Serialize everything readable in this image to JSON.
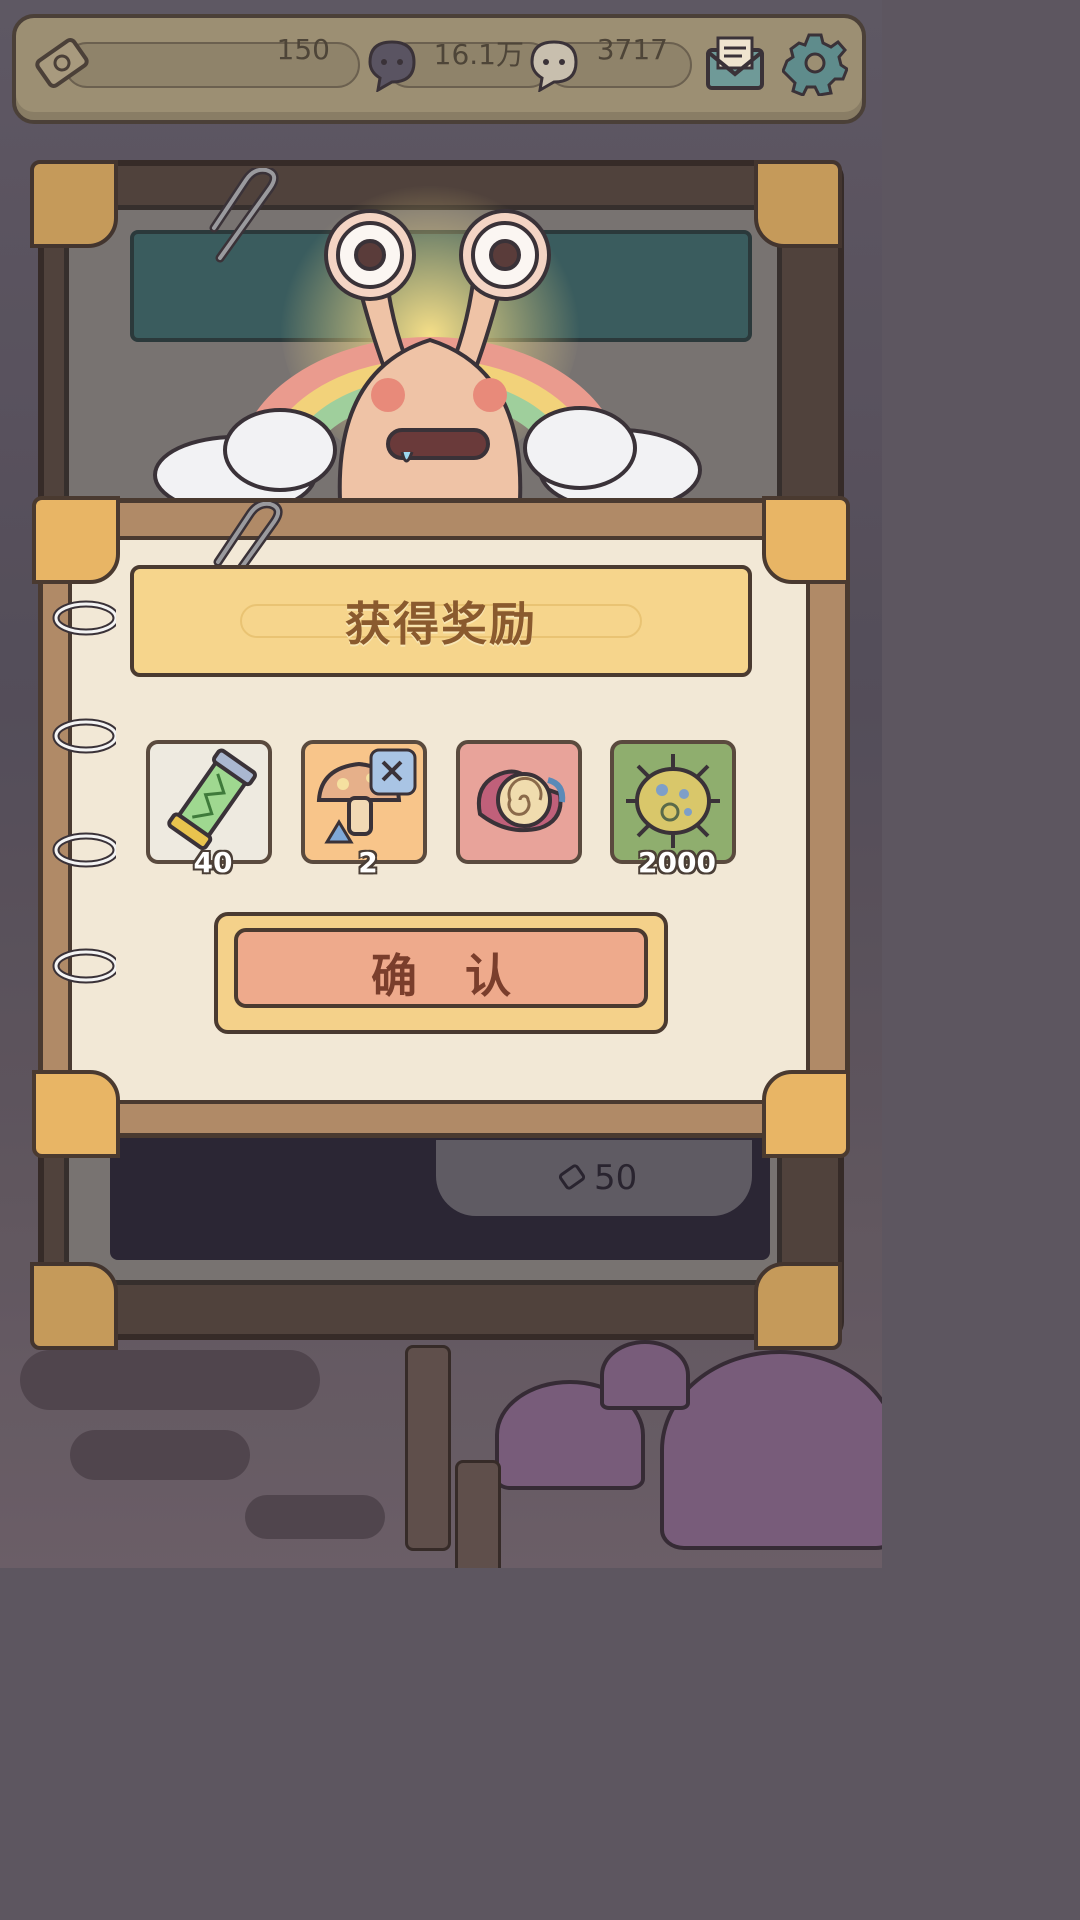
{
  "topbar": {
    "ticket_value": "150",
    "gem_value": "16.1万",
    "chat_value": "3717",
    "icons": [
      "ticket-icon",
      "dark-gem-icon",
      "chat-bubble-icon",
      "mail-icon",
      "gear-icon"
    ]
  },
  "popup": {
    "title": "获得奖励",
    "rewards": [
      {
        "icon": "battery-tube-icon",
        "count": "40",
        "bg": "#eeeae0"
      },
      {
        "icon": "mushroom-card-icon",
        "count": "2",
        "bg": "#f8c58a"
      },
      {
        "icon": "spiral-shell-icon",
        "count": "",
        "bg": "#e8a39a"
      },
      {
        "icon": "spotted-shell-icon",
        "count": "2000",
        "bg": "#8fae6e"
      }
    ],
    "confirm_label": "确认"
  },
  "background": {
    "cost_value": "50"
  }
}
